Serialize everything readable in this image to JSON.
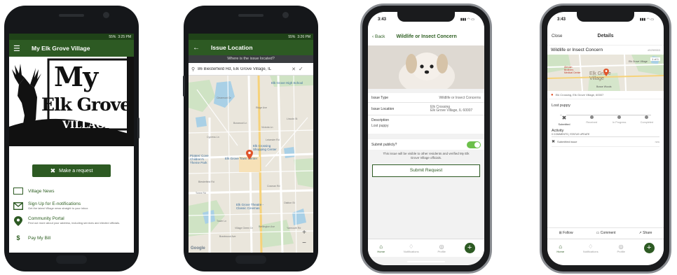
{
  "colors": {
    "brand_green": "#2d5a23",
    "accent_green": "#3a7a2a",
    "pin_orange": "#e0542a",
    "toggle_green": "#6cc04a"
  },
  "phone1": {
    "status_bar": {
      "signal": "55%",
      "time": "3:25 PM"
    },
    "header": {
      "title": "My Elk Grove Village"
    },
    "logo": {
      "line1": "My",
      "line2": "Elk Grove",
      "line3": "VILLAGE"
    },
    "make_request_label": "Make a request",
    "menu": [
      {
        "icon": "newspaper-icon",
        "title": "Village News",
        "desc": ""
      },
      {
        "icon": "envelope-icon",
        "title": "Sign Up for E-notifications",
        "desc": "Get the latest Village news straight to your inbox"
      },
      {
        "icon": "map-pin-icon",
        "title": "Community Portal",
        "desc": "Find out more about your address, including services and elected officials."
      },
      {
        "icon": "dollar-icon",
        "title": "Pay My Bill",
        "desc": ""
      }
    ]
  },
  "phone2": {
    "status_bar": {
      "signal": "55%",
      "time": "3:26 PM"
    },
    "header": {
      "title": "Issue Location",
      "prompt": "Where is the issue located?"
    },
    "search": {
      "value": "86 Biesterfield Rd, Elk Grove Village, IL"
    },
    "map": {
      "labels": [
        "Elk Grove High School",
        "Pirates' Cove Children's Theme Park",
        "Elk Grove Town Center",
        "Elk Crossing Shopping Center",
        "Elk Grove Theatre - Classic Cinemas"
      ],
      "streets": [
        "Biesterfield Rd",
        "Ridge Ave",
        "Cypress Ln",
        "Lincoln St",
        "Boxwood Ln",
        "Victoria Ln",
        "Clearmont Dr",
        "Leicester Rd",
        "Tonne Rd",
        "Cosman Rd",
        "Wellington Ave",
        "Village Green Dr",
        "Brantwood Ave",
        "Oakton St",
        "Yarmouth Rd",
        "Tower Ln"
      ],
      "google": "Google",
      "zoom_in": "+",
      "zoom_out": "−"
    }
  },
  "phone3": {
    "status_bar": {
      "time": "3:43"
    },
    "header": {
      "back": "Back",
      "title": "Wildlife or Insect Concern"
    },
    "fields": [
      {
        "label": "Issue Type",
        "value": "Wildlife or Insect Concerns"
      },
      {
        "label": "Issue Location",
        "value": "Elk Crossing",
        "value2": "Elk Grove Village, IL 60007"
      }
    ],
    "description": {
      "label": "Description",
      "value": "Lost puppy"
    },
    "submit_publicly": {
      "label": "Submit publicly?",
      "on": true
    },
    "notice": "This issue will be visible to other residents and verified My Elk Grove Village officials.",
    "submit_label": "Submit Request",
    "tabs": [
      {
        "label": "Home",
        "icon": "home-icon"
      },
      {
        "label": "Notifications",
        "icon": "bell-icon"
      },
      {
        "label": "Profile",
        "icon": "profile-icon"
      }
    ]
  },
  "phone4": {
    "status_bar": {
      "time": "3:43"
    },
    "header": {
      "close": "Close",
      "title": "Details"
    },
    "issue": {
      "title": "Wildlife or Insect Concern",
      "id": "#5259553"
    },
    "map": {
      "counter": "1 of 1",
      "labels": [
        "Elk Grove Village",
        "Alexian Brothers Medical Center",
        "Busse Woods",
        "Elk Grove Village"
      ]
    },
    "address": "Elk Crossing, Elk Grove Village, 60007",
    "description": "Lost puppy",
    "steps": [
      "Submitted",
      "Received",
      "In Progress",
      "Completed"
    ],
    "activity": {
      "title": "Activity",
      "meta": "0 COMMENTS | STATUS UPDATE",
      "entry": "Submitted issue",
      "time": "now"
    },
    "actions": [
      {
        "label": "Follow",
        "icon": "follow-icon"
      },
      {
        "label": "Comment",
        "icon": "comment-icon"
      },
      {
        "label": "Share",
        "icon": "share-icon"
      }
    ],
    "tabs": [
      {
        "label": "Home",
        "icon": "home-icon"
      },
      {
        "label": "Notifications",
        "icon": "bell-icon"
      },
      {
        "label": "Profile",
        "icon": "profile-icon"
      }
    ]
  }
}
